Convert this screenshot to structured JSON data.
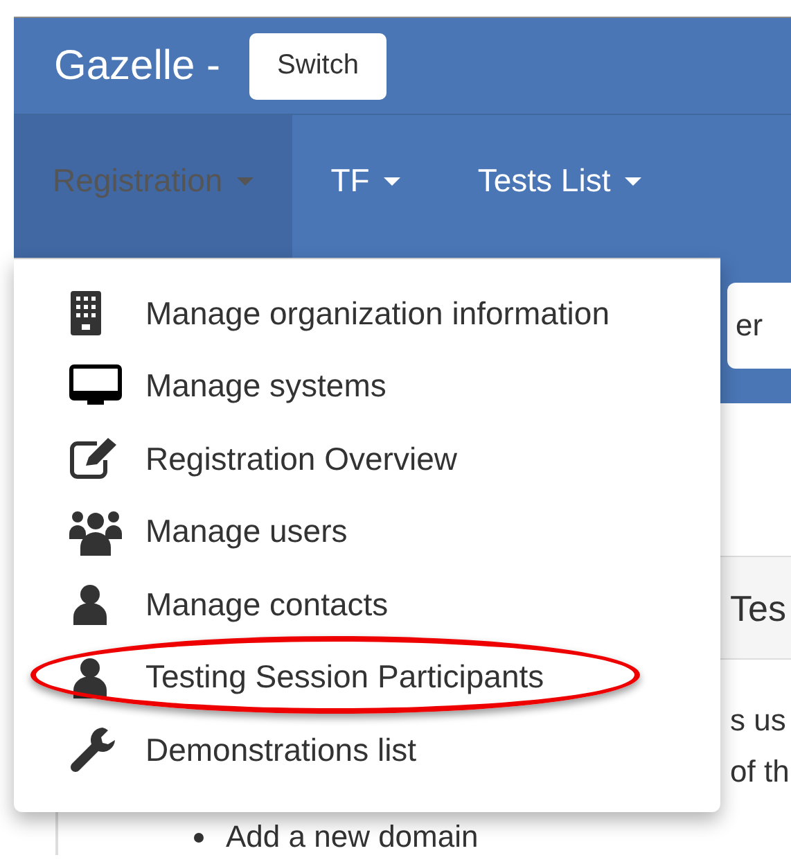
{
  "header": {
    "brand": "Gazelle -",
    "switch_button": "Switch"
  },
  "nav": [
    {
      "label": "Registration",
      "selected": true
    },
    {
      "label": "TF",
      "selected": false
    },
    {
      "label": "Tests List",
      "selected": false
    }
  ],
  "toolbar": {
    "button": "er"
  },
  "dropdown": {
    "items": [
      {
        "label": "Manage organization information",
        "kind": "building",
        "highlighted": false
      },
      {
        "label": "Manage systems",
        "kind": "monitor",
        "highlighted": false
      },
      {
        "label": "Registration Overview",
        "kind": "edit",
        "highlighted": false
      },
      {
        "label": "Manage users",
        "kind": "users",
        "highlighted": false
      },
      {
        "label": "Manage contacts",
        "kind": "user",
        "highlighted": false
      },
      {
        "label": "Testing Session Participants",
        "kind": "user",
        "highlighted": true
      },
      {
        "label": "Demonstrations list",
        "kind": "wrench",
        "highlighted": false
      }
    ]
  },
  "panel": {
    "heading": "Tes",
    "lines": [
      "s us",
      "of th"
    ],
    "bullets": [
      "Add a new domain"
    ]
  }
}
